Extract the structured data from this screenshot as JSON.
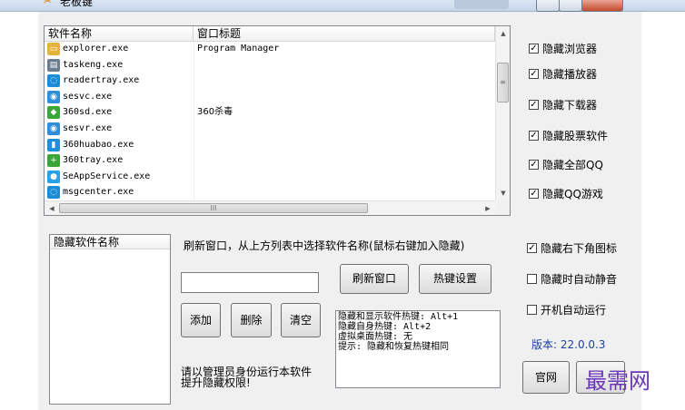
{
  "window": {
    "title": "老板键",
    "app_icon": "boss-key-app-icon"
  },
  "process_list": {
    "columns": [
      "软件名称",
      "窗口标题"
    ],
    "rows": [
      {
        "name": "explorer.exe",
        "window_title": "Program Manager",
        "icon": "explorer-folder-icon",
        "icon_color": "#e4b33b"
      },
      {
        "name": "taskeng.exe",
        "window_title": "",
        "icon": "window-app-icon",
        "icon_color": "#6c7d8f"
      },
      {
        "name": "readertray.exe",
        "window_title": "",
        "icon": "reader-tray-icon",
        "icon_color": "#1d8cd6"
      },
      {
        "name": "sesvc.exe",
        "window_title": "",
        "icon": "sesvc-icon",
        "icon_color": "#2f8fd8"
      },
      {
        "name": "360sd.exe",
        "window_title": "360杀毒",
        "icon": "360-shield-icon",
        "icon_color": "#3aa63a"
      },
      {
        "name": "sesvr.exe",
        "window_title": "",
        "icon": "sesvr-icon",
        "icon_color": "#2f8fd8"
      },
      {
        "name": "360huabao.exe",
        "window_title": "",
        "icon": "360huabao-icon",
        "icon_color": "#1e90d8"
      },
      {
        "name": "360tray.exe",
        "window_title": "",
        "icon": "360-plus-icon",
        "icon_color": "#3aa63a"
      },
      {
        "name": "SeAppService.exe",
        "window_title": "",
        "icon": "seapp-chat-icon",
        "icon_color": "#2aa0e6"
      },
      {
        "name": "msgcenter.exe",
        "window_title": "",
        "icon": "msgcenter-icon",
        "icon_color": "#1d8cd6"
      }
    ],
    "hscroll_glyph": "III"
  },
  "options": [
    {
      "label": "隐藏浏览器",
      "checked": true
    },
    {
      "label": "隐藏播放器",
      "checked": true
    },
    {
      "label": "隐藏下载器",
      "checked": true
    },
    {
      "label": "隐藏股票软件",
      "checked": true
    },
    {
      "label": "隐藏全部QQ",
      "checked": true
    },
    {
      "label": "隐藏QQ游戏",
      "checked": true
    }
  ],
  "hidden_list": {
    "header": "隐藏软件名称"
  },
  "hint": "刷新窗口，从上方列表中选择软件名称(鼠标右键加入隐藏)",
  "input": {
    "value": ""
  },
  "buttons": {
    "refresh": "刷新窗口",
    "hotkey_settings": "热键设置",
    "add": "添加",
    "delete": "删除",
    "clear": "清空",
    "website": "官网"
  },
  "hotkey_info": [
    "隐藏和显示软件热键: Alt+1",
    "隐藏自身热键: Alt+2",
    "虚拟桌面热键: 无",
    "提示: 隐藏和恢复热键相同"
  ],
  "settings": [
    {
      "label": "隐藏右下角图标",
      "checked": true
    },
    {
      "label": "隐藏时自动静音",
      "checked": false
    },
    {
      "label": "开机自动运行",
      "checked": false
    }
  ],
  "version": "版本: 22.0.0.3",
  "admin_note": [
    "请以管理员身份运行本软件",
    "提升隐藏权限!"
  ],
  "watermark": "最需网"
}
